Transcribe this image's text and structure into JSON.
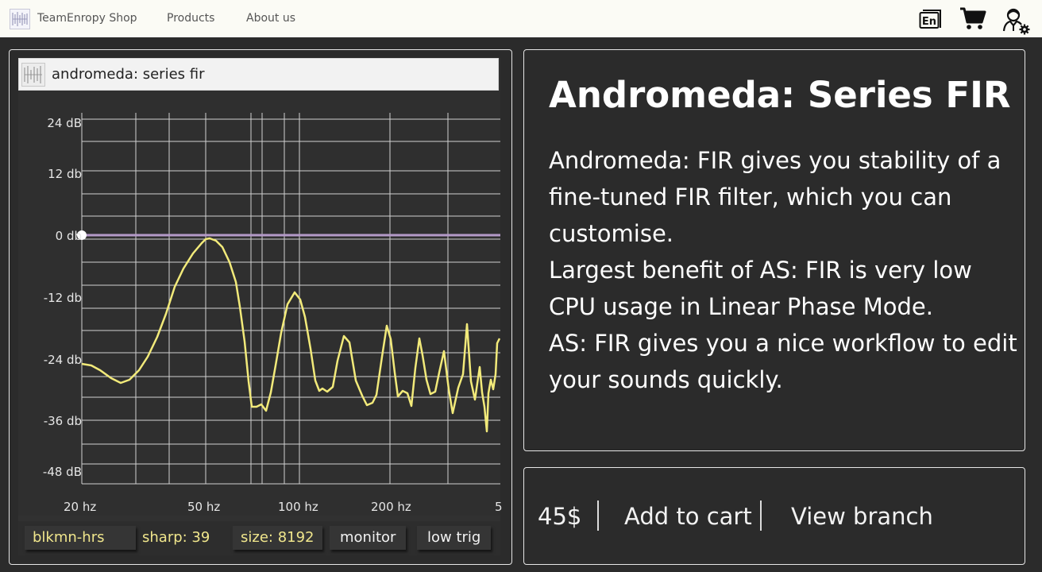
{
  "nav": {
    "brand": "TeamEnropy Shop",
    "products": "Products",
    "about": "About us",
    "icons": [
      "language-icon",
      "cart-icon",
      "user-settings-icon"
    ],
    "language_code": "En"
  },
  "plugin": {
    "title": "andromeda: series fir",
    "y_labels": [
      "24 dB",
      "12 db",
      "0 db",
      "-12 db",
      "-24 db",
      "-36 db",
      "-48 dB"
    ],
    "x_labels": [
      "20 hz",
      "50 hz",
      "100 hz",
      "200 hz",
      "5"
    ],
    "status": {
      "preset": "blkmn-hrs",
      "sharp": "sharp: 39",
      "size": "size: 8192",
      "monitor": "monitor",
      "trigger": "low trig"
    },
    "colors": {
      "curve": "#f2ea7a",
      "flat_line": "#b49ac8",
      "grid": "#d0d0d0"
    }
  },
  "product": {
    "title": "Andromeda: Series FIR",
    "description": [
      "Andromeda: FIR gives you stability of a fine-tuned FIR filter, which you can customise.",
      "Largest benefit of AS: FIR is very low CPU usage in Linear Phase Mode.",
      "AS: FIR gives you a nice workflow to edit your sounds quickly."
    ]
  },
  "buy": {
    "price": "45$",
    "add_to_cart": "Add to cart",
    "view_branch": "View branch"
  }
}
